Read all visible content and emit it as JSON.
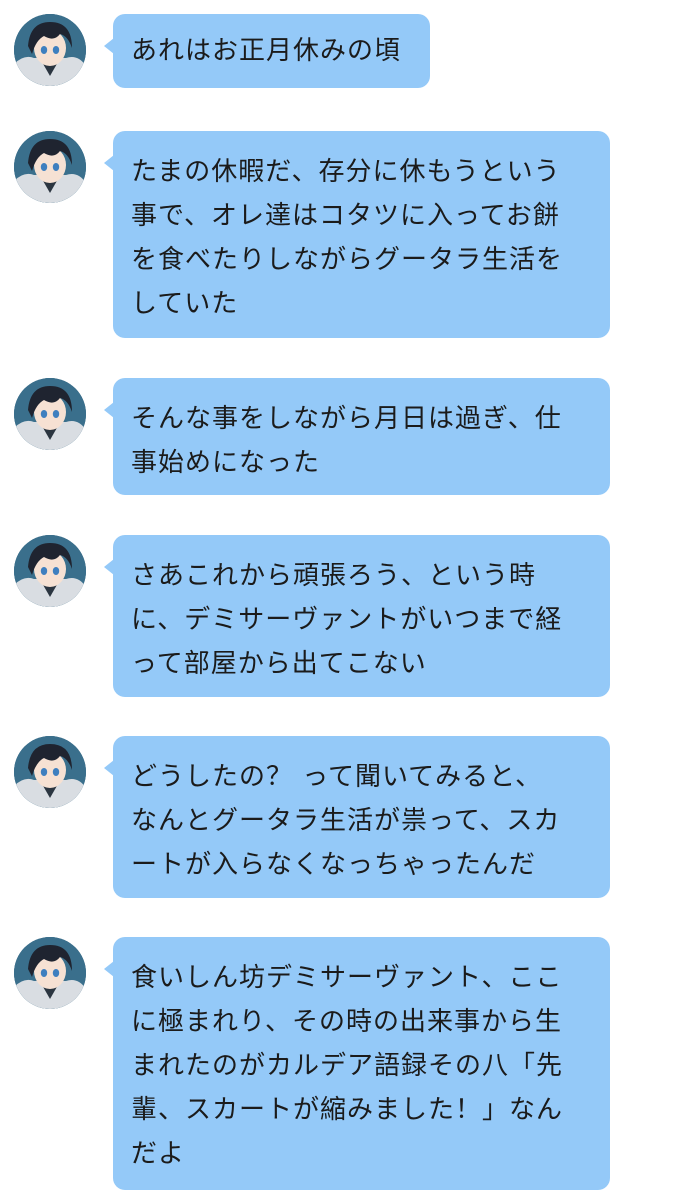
{
  "chat": {
    "messages": [
      {
        "text": "あれはお正月休みの頃",
        "avatar_icon": "character-avatar-icon"
      },
      {
        "text": "たまの休暇だ、存分に休もうという\n事で、オレ達はコタツに入ってお餅\nを食べたりしながらグータラ生活を\nしていた",
        "avatar_icon": "character-avatar-icon"
      },
      {
        "text": "そんな事をしながら月日は過ぎ、仕\n事始めになった",
        "avatar_icon": "character-avatar-icon"
      },
      {
        "text": "さあこれから頑張ろう、という時\nに、デミサーヴァントがいつまで経\nって部屋から出てこない",
        "avatar_icon": "character-avatar-icon"
      },
      {
        "text": "どうしたの？ って聞いてみると、\nなんとグータラ生活が祟って、スカ\nートが入らなくなっちゃったんだ",
        "avatar_icon": "character-avatar-icon"
      },
      {
        "text": "食いしん坊デミサーヴァント、ここ\nに極まれり、その時の出来事から生\nまれたのがカルデア語録その八「先\n輩、スカートが縮みました！」なん\nだよ",
        "avatar_icon": "character-avatar-icon"
      }
    ]
  },
  "colors": {
    "bubble": "#94c9f8",
    "text": "#1b1b1b",
    "background": "#ffffff"
  }
}
